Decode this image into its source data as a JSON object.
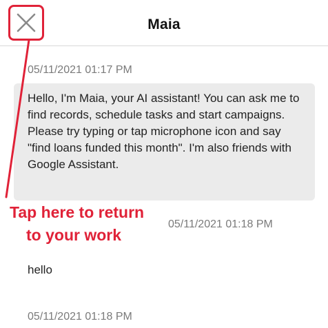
{
  "header": {
    "title": "Maia",
    "close_icon": "close-x-icon"
  },
  "messages": [
    {
      "timestamp": "05/11/2021 01:17 PM",
      "sender": "assistant",
      "text": "Hello, I'm Maia, your AI assistant! You can ask me to find records, schedule tasks and start campaigns. Please try typing or tap microphone icon and say \"find loans funded this month\". I'm also friends with Google Assistant."
    },
    {
      "timestamp": "05/11/2021 01:18 PM",
      "sender": "user",
      "text": "hello"
    },
    {
      "timestamp": "05/11/2021 01:18 PM",
      "sender": "assistant",
      "text": ""
    }
  ],
  "annotation": {
    "line1": "Tap here to return",
    "line2": "to your work"
  },
  "colors": {
    "annotation": "#e02238",
    "bubble": "#ebebeb",
    "timestamp": "#7a7a7a"
  }
}
